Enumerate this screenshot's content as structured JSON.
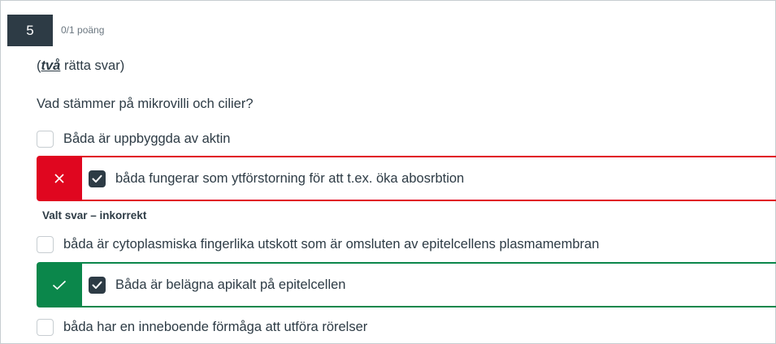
{
  "question": {
    "number": "5",
    "points": "0/1 poäng",
    "instruction_prefix": "(",
    "instruction_emphasis": "två",
    "instruction_suffix": " rätta svar)",
    "text": "Vad stämmer på mikrovilli och cilier?"
  },
  "options": [
    {
      "label": "Båda är uppbyggda av aktin",
      "checked": false
    },
    {
      "label": "båda fungerar som ytförstorning för att t.ex. öka abosrbtion",
      "checked": true,
      "status": "incorrect"
    },
    {
      "label": "båda är cytoplasmiska fingerlika utskott som är omsluten av epitelcellens plasmamembran",
      "checked": false
    },
    {
      "label": "Båda är belägna apikalt på epitelcellen",
      "checked": true,
      "status": "correct"
    },
    {
      "label": "båda har en inneboende förmåga att utföra rörelser",
      "checked": false
    }
  ],
  "feedback": {
    "selected_incorrect": "Valt svar – inkorrekt"
  },
  "colors": {
    "incorrect": "#e0061f",
    "correct": "#0b874b",
    "dark": "#2d3b45"
  },
  "icons": {
    "incorrect_marker": "close-icon",
    "correct_marker": "check-icon",
    "checkbox_checked": "checkmark-icon"
  }
}
